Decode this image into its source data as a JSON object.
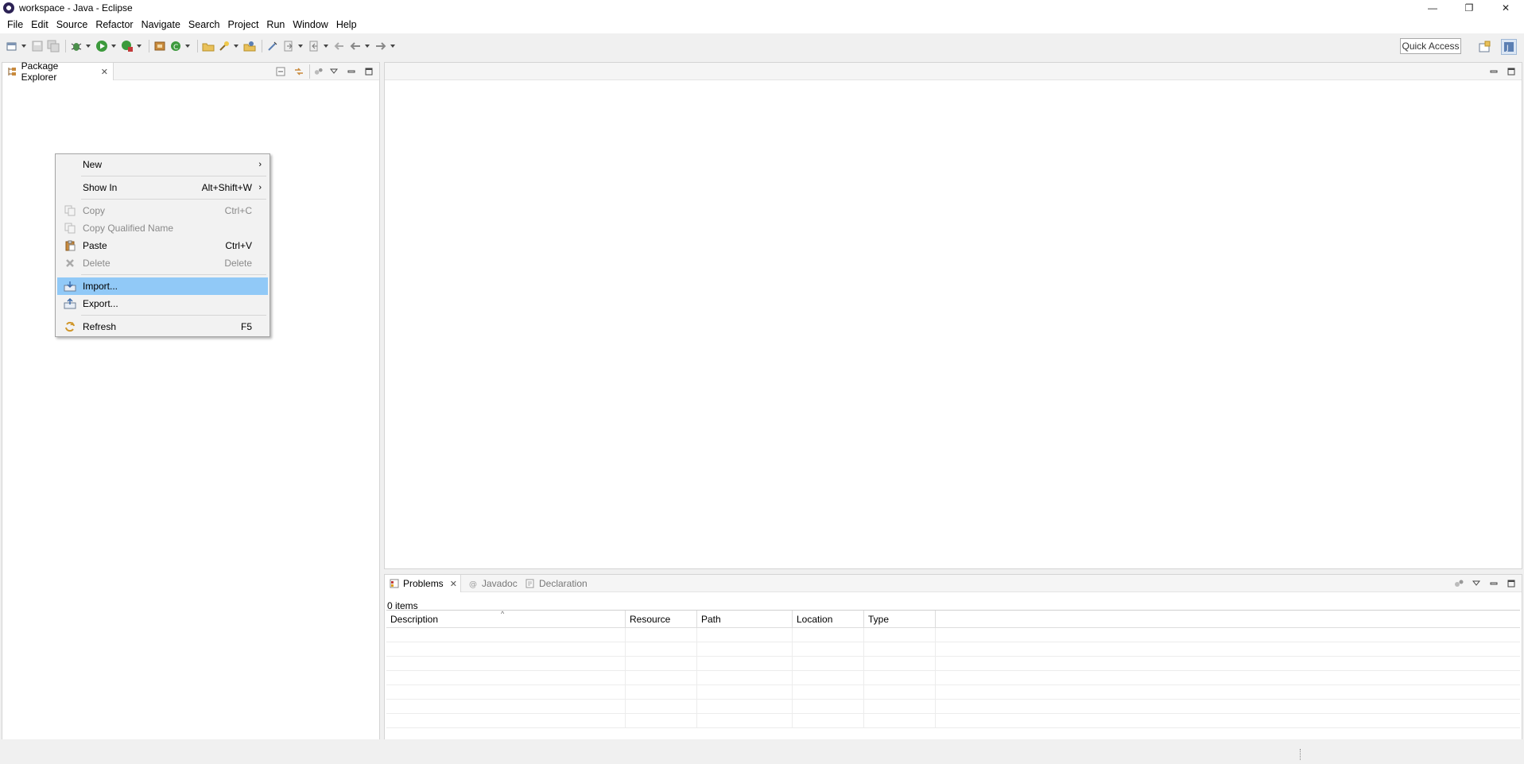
{
  "window": {
    "title": "workspace - Java - Eclipse",
    "controls": {
      "minimize": "—",
      "restore": "❐",
      "close": "✕"
    }
  },
  "menubar": {
    "items": [
      "File",
      "Edit",
      "Source",
      "Refactor",
      "Navigate",
      "Search",
      "Project",
      "Run",
      "Window",
      "Help"
    ]
  },
  "toolbar": {
    "quick_access": "Quick Access"
  },
  "package_explorer": {
    "tab_label": "Package Explorer",
    "close": "✕"
  },
  "context_menu": {
    "items": [
      {
        "label": "New",
        "shortcut": "",
        "submenu": true,
        "enabled": true,
        "icon": "none"
      },
      {
        "label": "Show In",
        "shortcut": "Alt+Shift+W",
        "submenu": true,
        "enabled": true,
        "icon": "none"
      },
      {
        "label": "Copy",
        "shortcut": "Ctrl+C",
        "submenu": false,
        "enabled": false,
        "icon": "copy-icon"
      },
      {
        "label": "Copy Qualified Name",
        "shortcut": "",
        "submenu": false,
        "enabled": false,
        "icon": "copy-qualified-icon"
      },
      {
        "label": "Paste",
        "shortcut": "Ctrl+V",
        "submenu": false,
        "enabled": true,
        "icon": "paste-icon"
      },
      {
        "label": "Delete",
        "shortcut": "Delete",
        "submenu": false,
        "enabled": false,
        "icon": "delete-icon"
      },
      {
        "label": "Import...",
        "shortcut": "",
        "submenu": false,
        "enabled": true,
        "highlighted": true,
        "icon": "import-icon"
      },
      {
        "label": "Export...",
        "shortcut": "",
        "submenu": false,
        "enabled": true,
        "icon": "export-icon"
      },
      {
        "label": "Refresh",
        "shortcut": "F5",
        "submenu": false,
        "enabled": true,
        "icon": "refresh-icon"
      }
    ],
    "submenu_arrow": "›"
  },
  "bottom_panel": {
    "tabs": [
      {
        "label": "Problems",
        "active": true,
        "close": "✕"
      },
      {
        "label": "Javadoc",
        "active": false
      },
      {
        "label": "Declaration",
        "active": false
      }
    ],
    "count": "0 items",
    "sort_indicator": "^",
    "columns": [
      "Description",
      "Resource",
      "Path",
      "Location",
      "Type"
    ]
  },
  "colors": {
    "highlight": "#91c9f7",
    "menu_bg": "#f2f2f2",
    "disabled_text": "#8a8a8a"
  }
}
